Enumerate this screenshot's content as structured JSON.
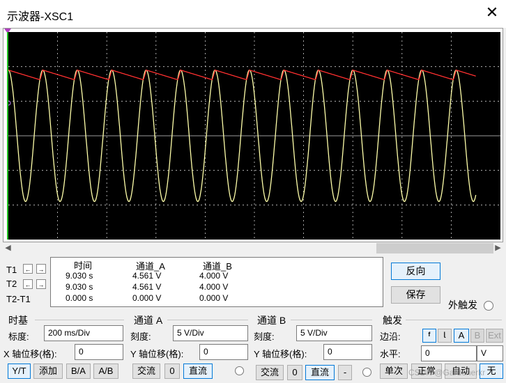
{
  "window": {
    "title": "示波器-XSC1",
    "close_glyph": "✕"
  },
  "colors": {
    "screen_bg": "#000000",
    "grid": "#d0d0d0",
    "trace_a": "#ffffaa",
    "trace_b": "#ff3030",
    "screen_border": "#1ec01e"
  },
  "scope": {
    "grid_divisions_x": 10,
    "grid_divisions_y": 6
  },
  "chart_data": {
    "type": "line",
    "title": "",
    "x_unit": "ms",
    "y_unit": "V",
    "time_per_div_ms": 200,
    "volts_per_div": 5,
    "x_range_ms": [
      0,
      2000
    ],
    "y_range_v": [
      -15,
      15
    ],
    "series": [
      {
        "channel": "A",
        "waveform": "sine",
        "amplitude_v": 9.5,
        "period_ms": 140,
        "color": "#ffffaa"
      },
      {
        "channel": "B",
        "waveform": "sawtooth-ripple",
        "peak_v": 9.5,
        "valley_v": 8.1,
        "period_ms": 140,
        "color": "#ff3030"
      }
    ],
    "grid": true
  },
  "cursors": {
    "t1_label": "T1",
    "t2_label": "T2",
    "diff_label": "T2-T1",
    "left_arrow": "←",
    "right_arrow": "→"
  },
  "readout": {
    "headers": [
      "时间",
      "通道_A",
      "通道_B"
    ],
    "rows": [
      [
        "9.030 s",
        "4.561 V",
        "4.000 V"
      ],
      [
        "9.030 s",
        "4.561 V",
        "4.000 V"
      ],
      [
        "0.000 s",
        "0.000 V",
        "0.000 V"
      ]
    ]
  },
  "actions": {
    "reverse": "反向",
    "save": "保存",
    "ext_trigger": "外触发"
  },
  "timebase": {
    "section": "时基",
    "scale_label": "标度:",
    "scale_value": "200 ms/Div",
    "xpos_label": "X 轴位移(格):",
    "xpos_value": "0",
    "modes": [
      "Y/T",
      "添加",
      "B/A",
      "A/B"
    ]
  },
  "channel_a": {
    "section": "通道 A",
    "scale_label": "刻度:",
    "scale_value": "5  V/Div",
    "ypos_label": "Y 轴位移(格):",
    "ypos_value": "0",
    "coupling": [
      "交流",
      "0",
      "直流"
    ]
  },
  "channel_b": {
    "section": "通道 B",
    "scale_label": "刻度:",
    "scale_value": "5  V/Div",
    "ypos_label": "Y 轴位移(格):",
    "ypos_value": "0",
    "coupling": [
      "交流",
      "0",
      "直流",
      "-"
    ]
  },
  "trigger": {
    "section": "触发",
    "edge_label": "边沿:",
    "edge_rise": "ᶠ",
    "edge_fall": "ᶩ",
    "sources": [
      "A",
      "B",
      "Ext"
    ],
    "level_label": "水平:",
    "level_value": "0",
    "level_unit": "V",
    "modes": [
      "单次",
      "正常",
      "自动",
      "无"
    ]
  },
  "watermark": "CSDN @Gardenerkr"
}
